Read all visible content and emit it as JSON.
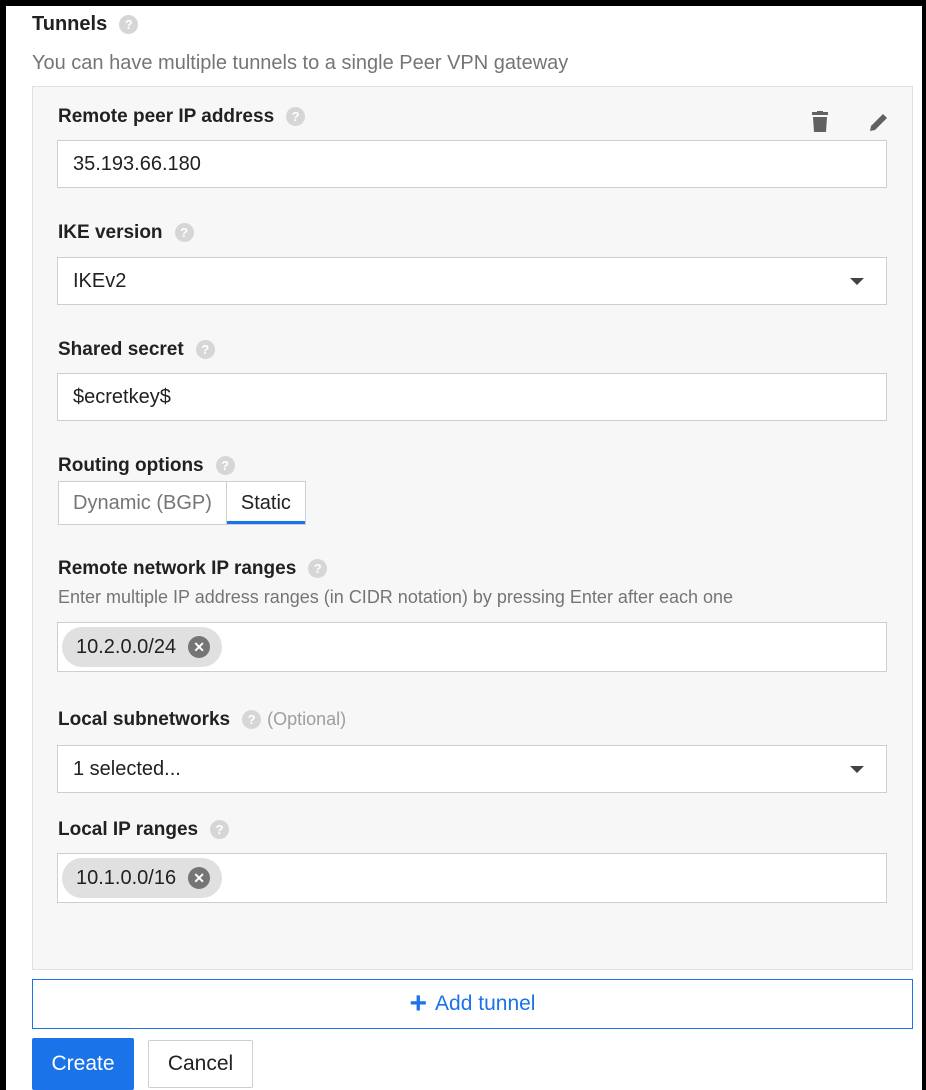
{
  "tunnels": {
    "title": "Tunnels",
    "subtitle": "You can have multiple tunnels to a single Peer VPN gateway",
    "help_icon": "?"
  },
  "tunnel": {
    "remote_peer": {
      "label": "Remote peer IP address",
      "value": "35.193.66.180"
    },
    "ike_version": {
      "label": "IKE version",
      "value": "IKEv2"
    },
    "shared_secret": {
      "label": "Shared secret",
      "value": "$ecretkey$"
    },
    "routing": {
      "label": "Routing options",
      "options": [
        "Dynamic (BGP)",
        "Static"
      ],
      "selected": "Static"
    },
    "remote_ranges": {
      "label": "Remote network IP ranges",
      "hint": "Enter multiple IP address ranges (in CIDR notation) by pressing Enter after each one",
      "chips": [
        "10.2.0.0/24"
      ]
    },
    "local_subnets": {
      "label": "Local subnetworks",
      "optional": "(Optional)",
      "value": "1 selected..."
    },
    "local_ranges": {
      "label": "Local IP ranges",
      "chips": [
        "10.1.0.0/16"
      ]
    }
  },
  "icons": {
    "delete": "delete-icon",
    "edit": "edit-icon"
  },
  "actions": {
    "add_tunnel": "Add tunnel",
    "create": "Create",
    "cancel": "Cancel"
  },
  "colors": {
    "accent": "#1a73e8"
  }
}
